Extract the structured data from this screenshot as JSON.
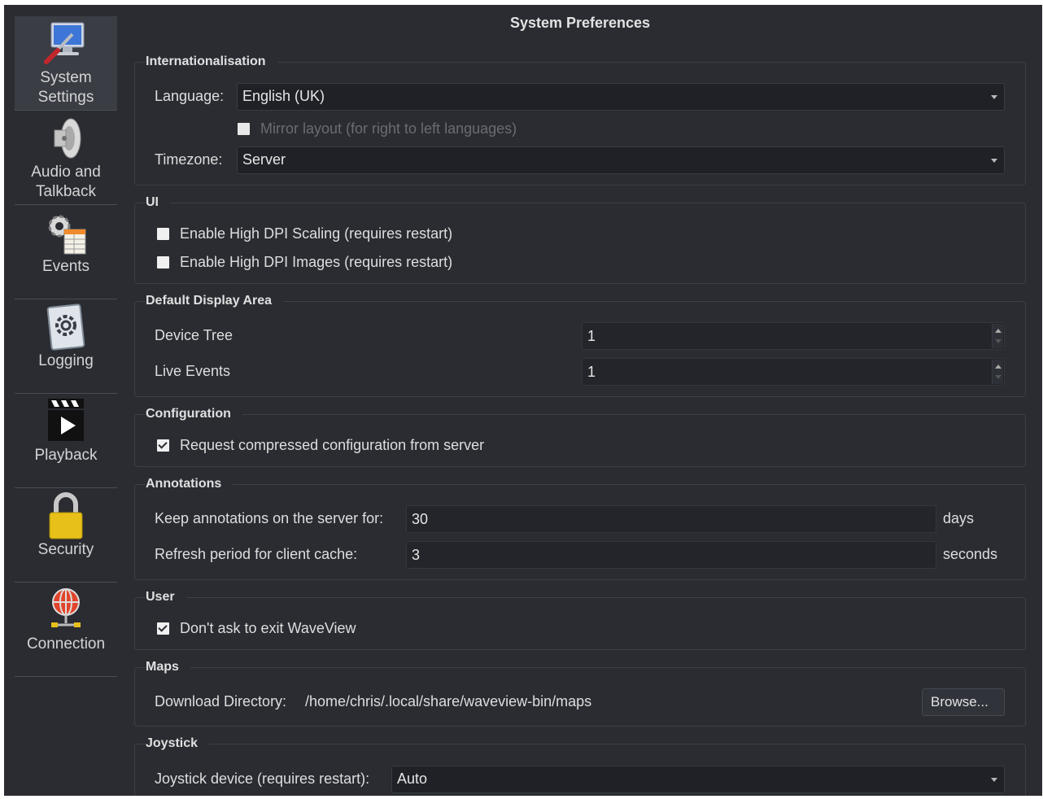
{
  "window": {
    "title": "System Preferences"
  },
  "sidebar": {
    "items": [
      {
        "label": "System Settings",
        "icon": "system-settings-icon"
      },
      {
        "label": "Audio and Talkback",
        "icon": "speaker-icon"
      },
      {
        "label": "Events",
        "icon": "events-icon"
      },
      {
        "label": "Logging",
        "icon": "logging-icon"
      },
      {
        "label": "Playback",
        "icon": "clapperboard-icon"
      },
      {
        "label": "Security",
        "icon": "padlock-icon"
      },
      {
        "label": "Connection",
        "icon": "globe-icon"
      }
    ]
  },
  "internationalisation": {
    "title": "Internationalisation",
    "language_label": "Language:",
    "language_value": "English (UK)",
    "mirror_label": "Mirror layout (for right to left languages)",
    "mirror_checked": false,
    "timezone_label": "Timezone:",
    "timezone_value": "Server"
  },
  "ui": {
    "title": "UI",
    "high_dpi_scaling_label": "Enable High DPI Scaling (requires restart)",
    "high_dpi_scaling_checked": false,
    "high_dpi_images_label": "Enable High DPI Images (requires restart)",
    "high_dpi_images_checked": false
  },
  "default_display_area": {
    "title": "Default Display Area",
    "device_tree_label": "Device Tree",
    "device_tree_value": "1",
    "live_events_label": "Live Events",
    "live_events_value": "1"
  },
  "configuration": {
    "title": "Configuration",
    "compressed_label": "Request compressed configuration from server",
    "compressed_checked": true
  },
  "annotations": {
    "title": "Annotations",
    "keep_label": "Keep annotations on the server for:",
    "keep_value": "30",
    "keep_unit": "days",
    "refresh_label": "Refresh period for client cache:",
    "refresh_value": "3",
    "refresh_unit": "seconds"
  },
  "user": {
    "title": "User",
    "no_exit_label": "Don't ask to exit WaveView",
    "no_exit_checked": true
  },
  "maps": {
    "title": "Maps",
    "dir_label": "Download Directory:",
    "dir_value": "/home/chris/.local/share/waveview-bin/maps",
    "browse_label": "Browse..."
  },
  "joystick": {
    "title": "Joystick",
    "device_label": "Joystick device (requires restart):",
    "device_value": "Auto"
  }
}
